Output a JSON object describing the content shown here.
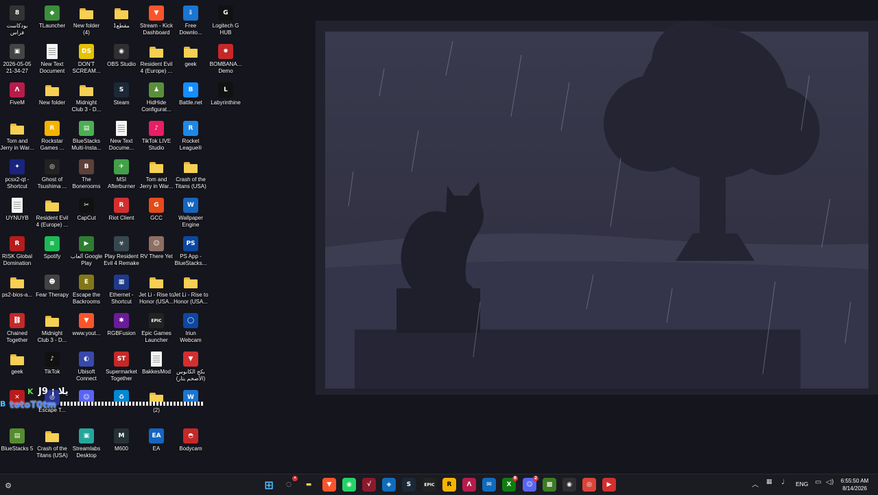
{
  "desktop": {
    "icons": [
      {
        "label": "بودكاست\nفراس",
        "kind": "img",
        "color": "#333",
        "glyph": "8"
      },
      {
        "label": "TLauncher",
        "kind": "img",
        "color": "#3a8f3a",
        "glyph": "◆"
      },
      {
        "label": "New folder\n(4)",
        "kind": "folder"
      },
      {
        "label": "مقطع1",
        "kind": "folder"
      },
      {
        "label": "Stream - Kick\nDashboard",
        "kind": "img",
        "color": "#fb542b",
        "glyph": "▼"
      },
      {
        "label": "Free\nDownlo...",
        "kind": "img",
        "color": "#1976d2",
        "glyph": "⇩"
      },
      {
        "label": "Logitech G\nHUB",
        "kind": "img",
        "color": "#111",
        "glyph": "G"
      },
      {
        "label": "2026-05-05\n21-34-27",
        "kind": "img",
        "color": "#444",
        "glyph": "▣"
      },
      {
        "label": "New Text\nDocument",
        "kind": "doc"
      },
      {
        "label": "DON'T\nSCREAM...",
        "kind": "img",
        "color": "#e6c200",
        "glyph": "DS"
      },
      {
        "label": "OBS Studio",
        "kind": "img",
        "color": "#302e31",
        "glyph": "◉"
      },
      {
        "label": "Resident Evil\n4 (Europe) ...",
        "kind": "folder"
      },
      {
        "label": "geek",
        "kind": "folder"
      },
      {
        "label": "BOMBANA...\nDemo",
        "kind": "img",
        "color": "#c62828",
        "glyph": "✹"
      },
      {
        "label": "FiveM",
        "kind": "img",
        "color": "#b71c4b",
        "glyph": "Λ"
      },
      {
        "label": "New folder",
        "kind": "folder"
      },
      {
        "label": "Midnight\nClub 3 - D...",
        "kind": "folder"
      },
      {
        "label": "Steam",
        "kind": "img",
        "color": "#1b2838",
        "glyph": "S"
      },
      {
        "label": "HidHide\nConfigurat...",
        "kind": "img",
        "color": "#5a8f3a",
        "glyph": "♟"
      },
      {
        "label": "Battle.net",
        "kind": "img",
        "color": "#148eff",
        "glyph": "B"
      },
      {
        "label": "Labyrinthine",
        "kind": "img",
        "color": "#111",
        "glyph": "L"
      },
      {
        "label": "Tom and\nJerry in War...",
        "kind": "folder"
      },
      {
        "label": "Rockstar\nGames ...",
        "kind": "img",
        "color": "#f4b400",
        "glyph": "R"
      },
      {
        "label": "BlueStacks\nMulti-Insta...",
        "kind": "img",
        "color": "#4caf50",
        "glyph": "▤"
      },
      {
        "label": "New Text\nDocume...",
        "kind": "doc"
      },
      {
        "label": "TikTok LIVE\nStudio",
        "kind": "img",
        "color": "#e91e63",
        "glyph": "♪"
      },
      {
        "label": "Rocket\nLeague®",
        "kind": "img",
        "color": "#1e88e5",
        "glyph": "R"
      },
      null,
      {
        "label": "pcsx2-qt -\nShortcut",
        "kind": "img",
        "color": "#1a237e",
        "glyph": "✦"
      },
      {
        "label": "Ghost of\nTsushima ...",
        "kind": "img",
        "color": "#222",
        "glyph": "◎"
      },
      {
        "label": "The\nBonerooms",
        "kind": "img",
        "color": "#5d4037",
        "glyph": "B"
      },
      {
        "label": "MSI\nAfterburner",
        "kind": "img",
        "color": "#43a047",
        "glyph": "✈"
      },
      {
        "label": "Tom and\nJerry in War...",
        "kind": "folder"
      },
      {
        "label": "Crash of the\nTitans (USA)",
        "kind": "folder"
      },
      null,
      {
        "label": "UYNUYB",
        "kind": "doc"
      },
      {
        "label": "Resident Evil\n4 (Europe) ...",
        "kind": "folder"
      },
      {
        "label": "CapCut",
        "kind": "img",
        "color": "#111",
        "glyph": "✂"
      },
      {
        "label": "Riot Client",
        "kind": "img",
        "color": "#d32f2f",
        "glyph": "R"
      },
      {
        "label": "GCC",
        "kind": "img",
        "color": "#e64a19",
        "glyph": "G"
      },
      {
        "label": "Wallpaper\nEngine",
        "kind": "img",
        "color": "#1565c0",
        "glyph": "W"
      },
      null,
      {
        "label": "RISK Global\nDomination",
        "kind": "img",
        "color": "#b71c1c",
        "glyph": "R"
      },
      {
        "label": "Spotify",
        "kind": "img",
        "color": "#1db954",
        "glyph": "≋"
      },
      {
        "label": "ألعاب Google\nPlay",
        "kind": "img",
        "color": "#2e7d32",
        "glyph": "▶"
      },
      {
        "label": "Play Resident\nEvil 4 Remake",
        "kind": "img",
        "color": "#37474f",
        "glyph": "☣"
      },
      {
        "label": "RV There Yet",
        "kind": "img",
        "color": "#8d6e63",
        "glyph": "☺"
      },
      {
        "label": "PS App -\nBlueStacks...",
        "kind": "img",
        "color": "#0d47a1",
        "glyph": "PS"
      },
      null,
      {
        "label": "ps2-bios-a...",
        "kind": "folder"
      },
      {
        "label": "Fear Therapy",
        "kind": "img",
        "color": "#424242",
        "glyph": "☻"
      },
      {
        "label": "Escape the\nBackrooms",
        "kind": "img",
        "color": "#827717",
        "glyph": "E"
      },
      {
        "label": "Ethernet -\nShortcut",
        "kind": "img",
        "color": "#1e3a8a",
        "glyph": "▦"
      },
      {
        "label": "Jet Li - Rise to\nHonor (USA...",
        "kind": "folder"
      },
      {
        "label": "Jet Li - Rise to\nHonor (USA...",
        "kind": "folder"
      },
      null,
      {
        "label": "Chained\nTogether",
        "kind": "img",
        "color": "#c62828",
        "glyph": "⛓"
      },
      {
        "label": "Midnight\nClub 3 - D...",
        "kind": "folder"
      },
      {
        "label": "www.yout...",
        "kind": "img",
        "color": "#fb542b",
        "glyph": "▼"
      },
      {
        "label": "RGBFusion",
        "kind": "img",
        "color": "#6a1b9a",
        "glyph": "✱"
      },
      {
        "label": "Epic Games\nLauncher",
        "kind": "img",
        "color": "#222",
        "glyph": "EPIC"
      },
      {
        "label": "Iriun\nWebcam",
        "kind": "img",
        "color": "#0d47a1",
        "glyph": "◯"
      },
      null,
      {
        "label": "geek",
        "kind": "folder"
      },
      {
        "label": "TikTok",
        "kind": "img",
        "color": "#111",
        "glyph": "♪"
      },
      {
        "label": "Ubisoft\nConnect",
        "kind": "img",
        "color": "#3949ab",
        "glyph": "◐"
      },
      {
        "label": "Supermarket\nTogether",
        "kind": "img",
        "color": "#c62828",
        "glyph": "ST"
      },
      {
        "label": "BakkesMod",
        "kind": "doc"
      },
      {
        "label": "بكج الكابوس\n(الأضخم بتار)",
        "kind": "img",
        "color": "#d32f2f",
        "glyph": "▼"
      },
      null,
      {
        "label": "",
        "kind": "img",
        "color": "#b71c1c",
        "glyph": "✕"
      },
      {
        "label": "Escape T...",
        "kind": "img",
        "color": "#283593",
        "glyph": "◎"
      },
      {
        "label": "",
        "kind": "img",
        "color": "#5865f2",
        "glyph": "☺"
      },
      {
        "label": "",
        "kind": "img",
        "color": "#0288d1",
        "glyph": "♻"
      },
      {
        "label": "(2)",
        "kind": "folder"
      },
      {
        "label": "",
        "kind": "img",
        "color": "#1976d2",
        "glyph": "W"
      },
      null,
      {
        "label": "BlueStacks 5",
        "kind": "img",
        "color": "#558b2f",
        "glyph": "▤"
      },
      {
        "label": "Crash of the\nTitans (USA)",
        "kind": "folder"
      },
      {
        "label": "Streamlabs\nDesktop",
        "kind": "img",
        "color": "#26a69a",
        "glyph": "▣"
      },
      {
        "label": "M600",
        "kind": "img",
        "color": "#263238",
        "glyph": "M"
      },
      {
        "label": "EA",
        "kind": "img",
        "color": "#1565c0",
        "glyph": "EA"
      },
      {
        "label": "Bodycam",
        "kind": "img",
        "color": "#c62828",
        "glyph": "◓"
      },
      null
    ]
  },
  "overlay": {
    "tag_a": "K",
    "tag_b": "J9 ¡ يلا",
    "tag_c": "totoT0tm",
    "tag_e": "B"
  },
  "taskbar": {
    "start_icon": "windows-start-icon",
    "pinned": [
      {
        "name": "windows-start",
        "glyph": "⊞",
        "color": "#4cc2ff",
        "bg": "transparent",
        "badge": ""
      },
      {
        "name": "copilot",
        "glyph": "◌",
        "color": "#ccc",
        "bg": "transparent",
        "badge": "•"
      },
      {
        "name": "file-explorer",
        "glyph": "▬",
        "color": "#f6d053",
        "bg": "transparent",
        "badge": ""
      },
      {
        "name": "brave",
        "glyph": "▼",
        "color": "#fff",
        "bg": "#fb542b",
        "badge": ""
      },
      {
        "name": "whatsapp",
        "glyph": "◉",
        "color": "#fff",
        "bg": "#25d366",
        "badge": ""
      },
      {
        "name": "adobe-app",
        "glyph": "√",
        "color": "#fff",
        "bg": "#8b1a2b",
        "badge": ""
      },
      {
        "name": "azure-data",
        "glyph": "◈",
        "color": "#fff",
        "bg": "#0f6cbd",
        "badge": ""
      },
      {
        "name": "steam",
        "glyph": "S",
        "color": "#fff",
        "bg": "#1b2838",
        "badge": ""
      },
      {
        "name": "epic-games",
        "glyph": "EPIC",
        "color": "#fff",
        "bg": "#222",
        "badge": ""
      },
      {
        "name": "rockstar",
        "glyph": "R",
        "color": "#000",
        "bg": "#f4b400",
        "badge": ""
      },
      {
        "name": "fivem",
        "glyph": "Λ",
        "color": "#fff",
        "bg": "#b71c4b",
        "badge": ""
      },
      {
        "name": "mail",
        "glyph": "✉",
        "color": "#fff",
        "bg": "#0f6cbd",
        "badge": ""
      },
      {
        "name": "xbox",
        "glyph": "X",
        "color": "#fff",
        "bg": "#107c10",
        "badge": "8"
      },
      {
        "name": "discord",
        "glyph": "☺",
        "color": "#fff",
        "bg": "#5865f2",
        "badge": "2"
      },
      {
        "name": "minecraft",
        "glyph": "▩",
        "color": "#fff",
        "bg": "#3b7d23",
        "badge": ""
      },
      {
        "name": "obs",
        "glyph": "◉",
        "color": "#fff",
        "bg": "#302e31",
        "badge": ""
      },
      {
        "name": "chrome",
        "glyph": "◎",
        "color": "#fff",
        "bg": "#db4437",
        "badge": ""
      },
      {
        "name": "streamlabs",
        "glyph": "▶",
        "color": "#fff",
        "bg": "#d32f2f",
        "badge": ""
      }
    ],
    "language": "ENG",
    "time": "6:55:50 AM",
    "date": "8/14/2026"
  }
}
